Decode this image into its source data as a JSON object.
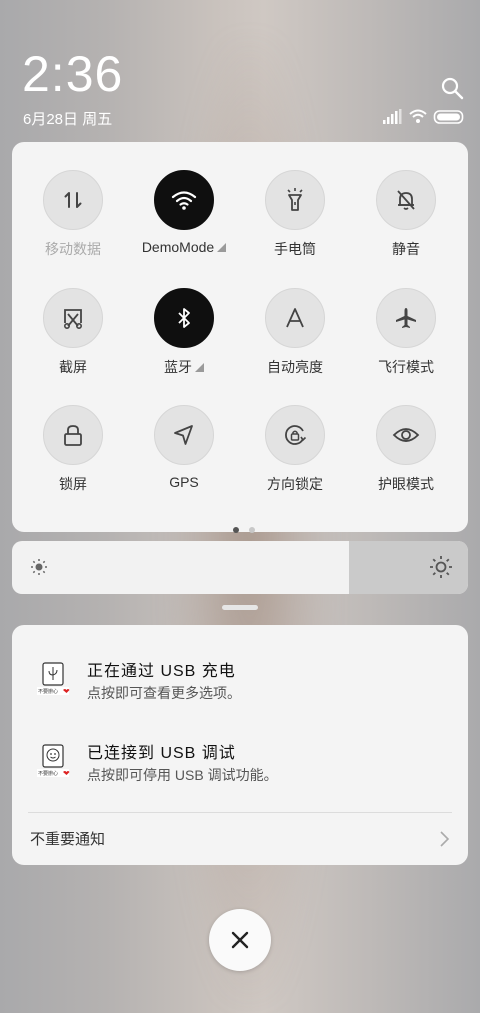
{
  "lockscreen": {
    "time": "2:36",
    "date": "6月28日 周五"
  },
  "quick_settings": {
    "tiles": [
      {
        "label": "移动数据",
        "icon": "mobile-data-icon",
        "on": false
      },
      {
        "label": "DemoMode",
        "icon": "wifi-icon",
        "on": true
      },
      {
        "label": "手电筒",
        "icon": "flashlight-icon",
        "on": false
      },
      {
        "label": "静音",
        "icon": "mute-bell-icon",
        "on": false
      },
      {
        "label": "截屏",
        "icon": "screenshot-icon",
        "on": false
      },
      {
        "label": "蓝牙",
        "icon": "bluetooth-icon",
        "on": true
      },
      {
        "label": "自动亮度",
        "icon": "auto-brightness-icon",
        "on": false
      },
      {
        "label": "飞行模式",
        "icon": "airplane-icon",
        "on": false
      },
      {
        "label": "锁屏",
        "icon": "lock-icon",
        "on": false
      },
      {
        "label": "GPS",
        "icon": "gps-icon",
        "on": false
      },
      {
        "label": "方向锁定",
        "icon": "rotation-lock-icon",
        "on": false
      },
      {
        "label": "护眼模式",
        "icon": "eye-icon",
        "on": false
      }
    ],
    "page_count": 2,
    "current_page": 1
  },
  "brightness": {
    "level": 0.74
  },
  "notifications": [
    {
      "title": "正在通过 USB 充电",
      "subtitle": "点按即可查看更多选项。",
      "icon": "usb-charge-app-icon"
    },
    {
      "title": "已连接到 USB 调试",
      "subtitle": "点按即可停用 USB 调试功能。",
      "icon": "usb-debug-app-icon"
    }
  ],
  "unimportant": {
    "label": "不重要通知"
  },
  "colors": {
    "tile_on": "#0f0f0f",
    "tile_off": "#e3e3e3",
    "panel": "#f4f4f4"
  }
}
